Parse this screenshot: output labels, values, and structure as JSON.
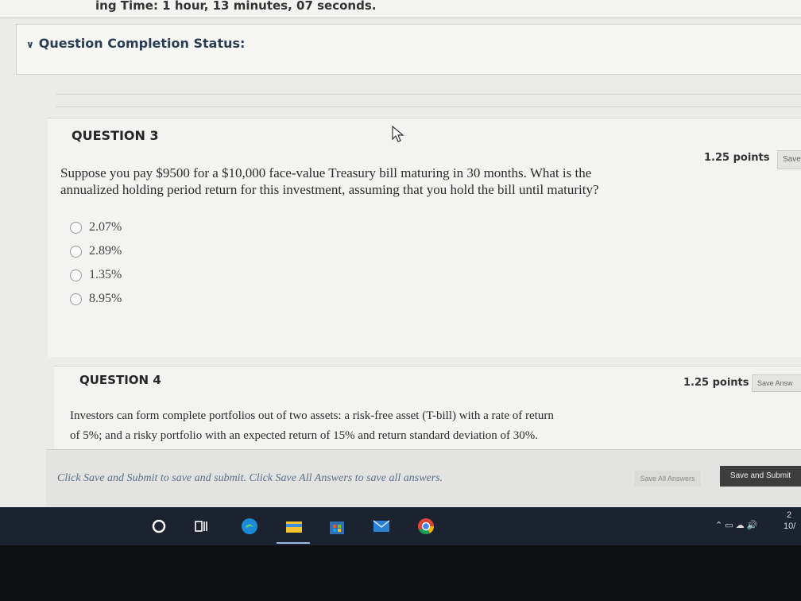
{
  "timer": {
    "text": "ing Time: 1 hour, 13 minutes, 07 seconds."
  },
  "status": {
    "label": "Question Completion Status:"
  },
  "question3": {
    "title": "QUESTION 3",
    "points": "1.25 points",
    "save_label": "Save",
    "text_line1": "Suppose you pay $9500 for a $10,000 face-value Treasury bill maturing in 30 months. What is the",
    "text_line2": "annualized holding period return for this investment, assuming that you hold the bill until maturity?",
    "choices": [
      "2.07%",
      "2.89%",
      "1.35%",
      "8.95%"
    ]
  },
  "question4": {
    "title": "QUESTION 4",
    "points": "1.25 points",
    "save_label": "Save Answ",
    "text_line1": "Investors can form complete portfolios out of two assets: a risk-free asset (T-bill) with a rate of return",
    "text_line2": "of 5%; and a risky portfolio with an expected return of 15% and return standard deviation of 30%."
  },
  "footer": {
    "instruction": "Click Save and Submit to save and submit. Click Save All Answers to save all answers.",
    "save_all_label": "Save All Answers",
    "submit_label": "Save and Submit"
  },
  "taskbar": {
    "icons": [
      "search-icon",
      "task-view-icon",
      "edge-icon",
      "file-explorer-icon",
      "store-icon",
      "mail-icon",
      "chrome-icon"
    ],
    "time": "2",
    "date": "10/"
  }
}
